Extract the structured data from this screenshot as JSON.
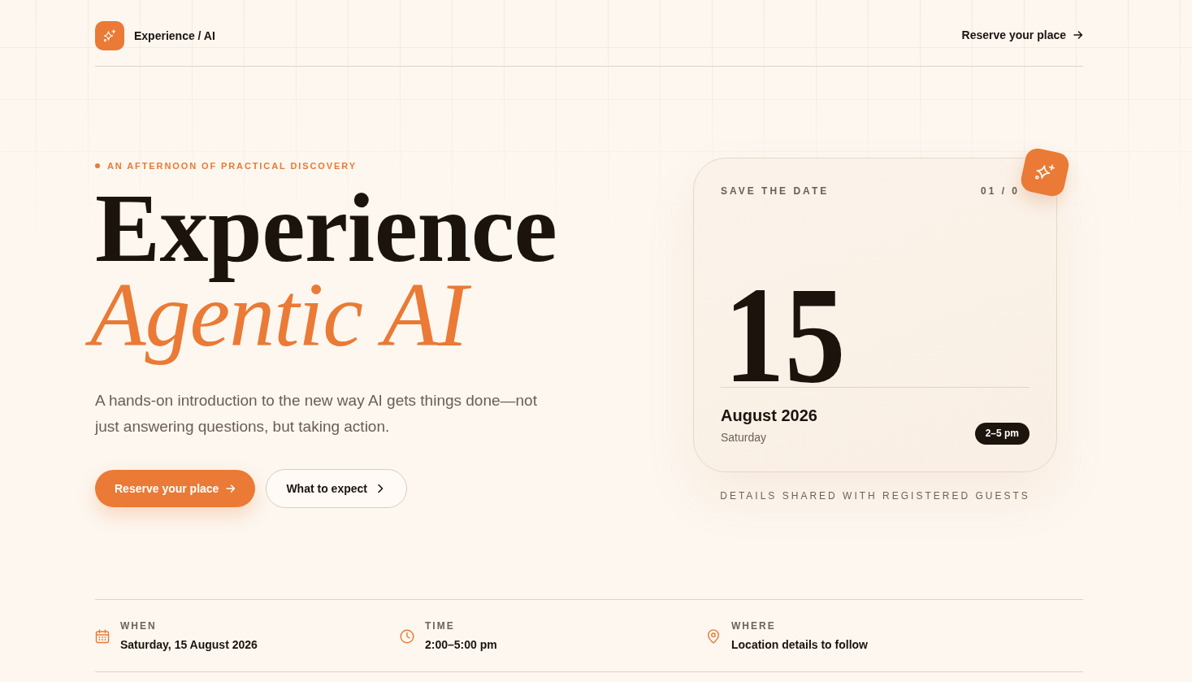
{
  "header": {
    "brand": "Experience / AI",
    "link": "Reserve your place"
  },
  "hero": {
    "eyebrow": "AN AFTERNOON OF PRACTICAL DISCOVERY",
    "title_line_1": "Experience",
    "title_line_2": "Agentic AI",
    "description": "A hands-on introduction to the new way AI gets things done—not just answering questions, but taking action.",
    "buttons": [
      {
        "label": "Reserve your place",
        "kind": "primary"
      },
      {
        "label": "What to expect",
        "kind": "secondary"
      }
    ]
  },
  "date_card": {
    "label": "SAVE THE DATE",
    "counter": "01 / 0",
    "day": "15",
    "month_year": "August 2026",
    "weekday": "Saturday",
    "time_badge": "2–5 pm"
  },
  "card_note": "DETAILS SHARED WITH REGISTERED GUESTS",
  "details": [
    {
      "kind": "calendar",
      "label": "WHEN",
      "value": "Saturday, 15 August 2026"
    },
    {
      "kind": "clock",
      "label": "TIME",
      "value": "2:00–5:00 pm"
    },
    {
      "kind": "pin",
      "label": "WHERE",
      "value": "Location details to follow"
    }
  ]
}
